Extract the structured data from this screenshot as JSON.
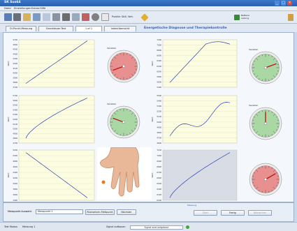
{
  "window": {
    "title": "SK Sus64",
    "min": "_",
    "max": "□",
    "close": "×"
  },
  "menu": [
    "Datei",
    "Einstellungen",
    "Extras",
    "Hilfe"
  ],
  "toolbar": {
    "icons": [
      "print-icon",
      "printer-icon",
      "chart-icon",
      "list-icon",
      "image-icon",
      "settings-icon",
      "tools-icon",
      "scissors-icon",
      "brain-icon",
      "globe-icon",
      "question-icon"
    ],
    "text_button": "Punkte: Skill, Vert.",
    "right_info": "Batterie\nLadung"
  },
  "tabs": [
    {
      "label": "Ol-Punkt-Messung",
      "active": false
    },
    {
      "label": "Ganzkörper-Test",
      "active": false
    },
    {
      "label": "1 of 1",
      "active": true
    },
    {
      "label": "Indexübersicht",
      "active": false
    }
  ],
  "section_title": "Energetische Diagnose und Therapiekontrolle",
  "panels": [
    {
      "yticks": [
        "4700",
        "4600",
        "4500",
        "4400",
        "4300",
        "4200",
        "4100",
        "4000",
        "3900",
        "3800",
        "3700"
      ],
      "ylabel": "Wert",
      "gauge_label": "Variation",
      "gauge": "red"
    },
    {
      "yticks": [
        "7200",
        "7000",
        "6800",
        "6600",
        "6400",
        "6200",
        "6000",
        "5800",
        "5600",
        "5400"
      ],
      "ylabel": "Wert",
      "gauge_label": "Variation",
      "gauge": "green"
    },
    {
      "yticks": [
        "5700",
        "5600",
        "5500",
        "5400",
        "5300",
        "5200",
        "5100",
        "5000",
        "4900",
        "4800",
        "4700"
      ],
      "ylabel": "Wert",
      "gauge_label": "Variation",
      "gauge": "green"
    },
    {
      "yticks": [
        "5500",
        "5400",
        "5300",
        "5200",
        "5100",
        "5000",
        "4900",
        "4800",
        "4700",
        "4600"
      ],
      "ylabel": "Wert",
      "gauge_label": "Variation",
      "gauge": "green"
    },
    {
      "yticks": [
        "5200",
        "5000",
        "4800",
        "4600",
        "4400",
        "4200",
        "4000",
        "3800",
        "3600",
        "3400"
      ],
      "ylabel": "Wert",
      "gauge_label": "",
      "gauge": "none"
    },
    {
      "yticks": [
        "7100",
        "7000",
        "6900",
        "6800",
        "6700",
        "6600",
        "6500",
        "6400",
        "6300",
        "6200"
      ],
      "ylabel": "Wert",
      "gauge_label": "",
      "gauge": "red"
    }
  ],
  "bottom": {
    "select_label": "Messpunkt Auswahl:",
    "select_value": "Messpunkt 1",
    "btn_prev": "Rücksetzen Meßpunkt",
    "btn_next": "Nächster",
    "group_label": "Messung",
    "btn_start": "Start",
    "btn_done": "Fertig",
    "btn_cancel": "Abbrechen"
  },
  "status": {
    "left": "Test Modus",
    "left_value": "Messung 1",
    "mid_label": "Signal aufbauen",
    "mid_value": "Signal wird aufgebaut"
  },
  "colors": {
    "red_gauge": "#e8908f",
    "green_gauge": "#a9d8a4",
    "line": "#2a3fb0",
    "needle": "#c01818"
  }
}
